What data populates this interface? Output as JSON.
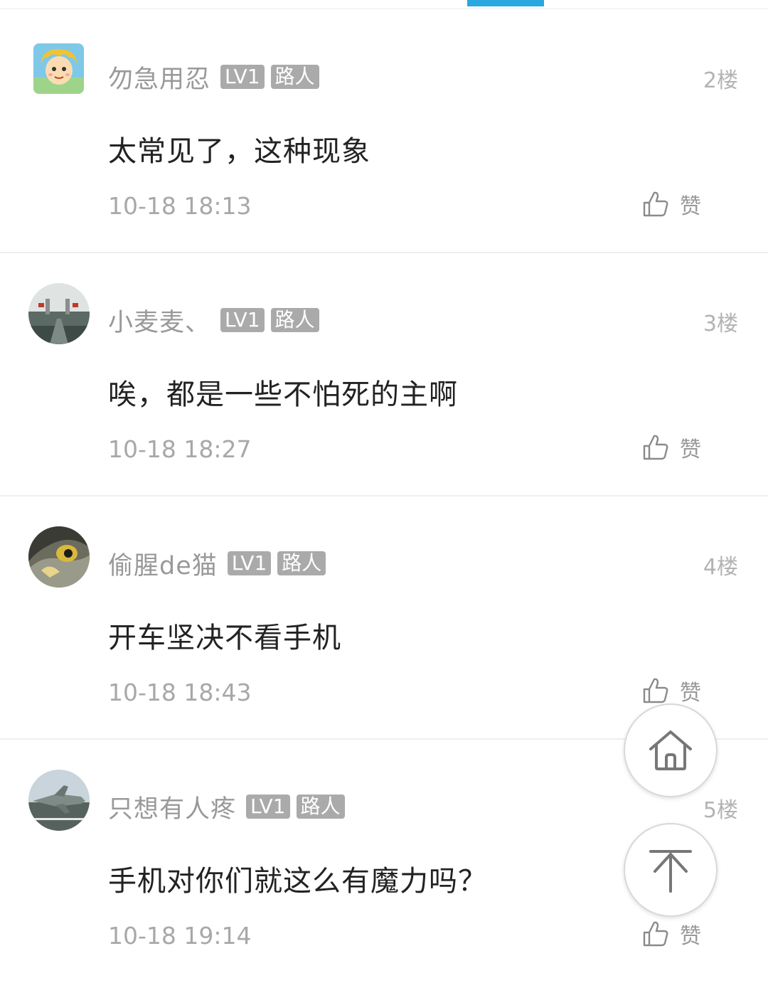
{
  "comments": [
    {
      "username": "勿急用忍",
      "level": "LV1",
      "role": "路人",
      "floor": "2楼",
      "content": "太常见了，这种现象",
      "time": "10-18 18:13",
      "like_label": "赞",
      "avatar_icon": "cartoon-face-avatar"
    },
    {
      "username": "小麦麦、",
      "level": "LV1",
      "role": "路人",
      "floor": "3楼",
      "content": "唉，都是一些不怕死的主啊",
      "time": "10-18 18:27",
      "like_label": "赞",
      "avatar_icon": "photo-avatar"
    },
    {
      "username": "偷腥de猫",
      "level": "LV1",
      "role": "路人",
      "floor": "4楼",
      "content": "开车坚决不看手机",
      "time": "10-18 18:43",
      "like_label": "赞",
      "avatar_icon": "eagle-avatar"
    },
    {
      "username": "只想有人疼",
      "level": "LV1",
      "role": "路人",
      "floor": "5楼",
      "content": "手机对你们就这么有魔力吗？",
      "time": "10-18 19:14",
      "like_label": "赞",
      "avatar_icon": "jet-avatar"
    }
  ],
  "floating_buttons": {
    "home_icon": "home-icon",
    "top_icon": "back-to-top-icon"
  },
  "colors": {
    "accent": "#2aa7de",
    "badge": "#aaaaaa",
    "meta_text": "#999999"
  }
}
